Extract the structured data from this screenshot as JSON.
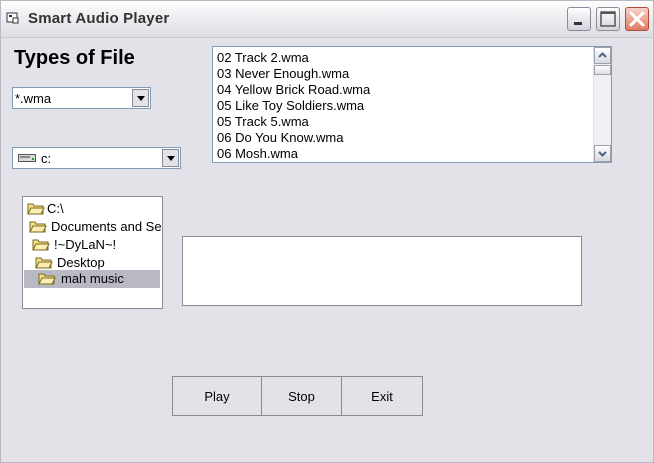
{
  "window": {
    "title": "Smart Audio Player"
  },
  "heading": "Types of File",
  "file_type_combo": {
    "value": "*.wma"
  },
  "drive_combo": {
    "value": "c:"
  },
  "file_list": {
    "items": [
      "02 Track 2.wma",
      "03 Never Enough.wma",
      "04 Yellow Brick Road.wma",
      "05 Like Toy Soldiers.wma",
      "05 Track 5.wma",
      "06 Do You Know.wma",
      "06 Mosh.wma"
    ]
  },
  "folder_tree": {
    "items": [
      "C:\\",
      "Documents and Se",
      "!~DyLaN~!",
      "Desktop",
      "mah music"
    ],
    "selected": "mah music"
  },
  "buttons": {
    "play": "Play",
    "stop": "Stop",
    "exit": "Exit"
  },
  "colors": {
    "window_bg": "#e3e2e8",
    "selection": "#b9b9c3",
    "close_button": "#e07a63",
    "field_border": "#7f9db9"
  }
}
